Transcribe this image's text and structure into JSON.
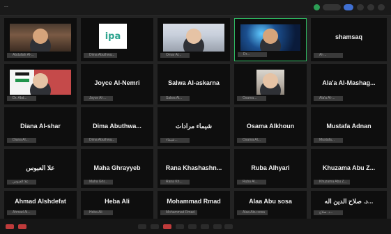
{
  "window": {
    "title": "..."
  },
  "tiles": [
    {
      "id": "t1",
      "kind": "video",
      "name": "",
      "nametag": "Abdullah Al-..."
    },
    {
      "id": "t2",
      "kind": "logo",
      "name": "",
      "nametag": "Dima Abuthwa..."
    },
    {
      "id": "t3",
      "kind": "video",
      "name": "",
      "nametag": "Omar Al..."
    },
    {
      "id": "t4",
      "kind": "video",
      "name": "",
      "nametag": "Dr..."
    },
    {
      "id": "t5",
      "kind": "text",
      "name": "shamsaq",
      "nametag": "Al-..."
    },
    {
      "id": "t6",
      "kind": "video",
      "name": "",
      "nametag": "Dr. Abd..."
    },
    {
      "id": "t7",
      "kind": "text",
      "name": "Joyce Al-Nemri",
      "nametag": "Joyce Al-..."
    },
    {
      "id": "t8",
      "kind": "text",
      "name": "Salwa Al-askarna",
      "nametag": "Salwa Al..."
    },
    {
      "id": "t9",
      "kind": "video",
      "name": "",
      "nametag": "Osama..."
    },
    {
      "id": "t10",
      "kind": "text",
      "name": "Ala'a Al-Mashag...",
      "nametag": "Ala'a Al-..."
    },
    {
      "id": "t11",
      "kind": "text",
      "name": "Diana Al-shar",
      "nametag": "Diana Al..."
    },
    {
      "id": "t12",
      "kind": "text",
      "name": "Dima Abuthwa...",
      "nametag": "Dima Abuthwa..."
    },
    {
      "id": "t13",
      "kind": "text",
      "name": "شيماء مرادات",
      "nametag": "شيماء..."
    },
    {
      "id": "t14",
      "kind": "text",
      "name": "Osama Alkhoun",
      "nametag": "Osama Al..."
    },
    {
      "id": "t15",
      "kind": "text",
      "name": "Mustafa Adnan",
      "nametag": "Mustafa..."
    },
    {
      "id": "t16",
      "kind": "text",
      "name": "علا العبوس",
      "nametag": "علا العبوس"
    },
    {
      "id": "t17",
      "kind": "text",
      "name": "Maha Ghrayyeb",
      "nametag": "Maha Ghr..."
    },
    {
      "id": "t18",
      "kind": "text",
      "name": "Rana Khashashn...",
      "nametag": "Rana Kh..."
    },
    {
      "id": "t19",
      "kind": "text",
      "name": "Ruba Alhyari",
      "nametag": "Ruba Al..."
    },
    {
      "id": "t20",
      "kind": "text",
      "name": "Khuzama Abu Z...",
      "nametag": "Khuzama Abu Z..."
    },
    {
      "id": "t21",
      "kind": "text",
      "name": "Ahmad Alshdefat",
      "nametag": "Ahmad Al..."
    },
    {
      "id": "t22",
      "kind": "text",
      "name": "Heba Ali",
      "nametag": "Heba Ali"
    },
    {
      "id": "t23",
      "kind": "text",
      "name": "Mohammad Rmad",
      "nametag": "Mohammad Rmad"
    },
    {
      "id": "t24",
      "kind": "text",
      "name": "Alaa Abu sosa",
      "nametag": "Alaa Abu sosa"
    },
    {
      "id": "t25",
      "kind": "text",
      "name": "د. صلاح الدين اله...",
      "nametag": "د. صلاح..."
    }
  ],
  "icons": {
    "mic_muted": "mic-muted-icon"
  },
  "colors": {
    "background": "#232323",
    "tile": "#0e0e0e",
    "active_border": "#2fba62",
    "muted": "#e24b4b"
  }
}
